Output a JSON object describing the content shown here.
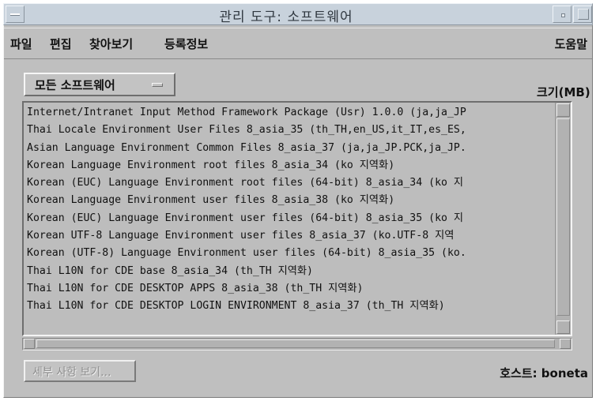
{
  "window": {
    "title": "관리 도구: 소프트웨어"
  },
  "menubar": {
    "file": "파일",
    "edit": "편집",
    "browse": "찾아보기",
    "register": "등록정보",
    "help": "도움말"
  },
  "filter": {
    "selected": "모든 소프트웨어"
  },
  "list": {
    "size_header": "크기(MB)",
    "rows": [
      "Internet/Intranet Input Method Framework Package (Usr) 1.0.0 (ja,ja_JP",
      "Thai Locale Environment User Files 8_asia_35 (th_TH,en_US,it_IT,es_ES,",
      "Asian Language Environment Common Files 8_asia_37 (ja,ja_JP.PCK,ja_JP.",
      "Korean Language Environment root files 8_asia_34 (ko 지역화)",
      "Korean (EUC) Language Environment root files (64-bit) 8_asia_34 (ko 지",
      "Korean Language Environment user files 8_asia_38 (ko 지역화)",
      "Korean (EUC) Language Environment user files (64-bit) 8_asia_35 (ko 지",
      "Korean UTF-8 Language Environment user files 8_asia_37 (ko.UTF-8 지역",
      "Korean (UTF-8) Language Environment user files (64-bit) 8_asia_35 (ko.",
      "Thai L10N for CDE base 8_asia_34 (th_TH 지역화)",
      "Thai L10N for CDE DESKTOP APPS 8_asia_38 (th_TH 지역화)",
      "Thai L10N for CDE DESKTOP LOGIN ENVIRONMENT 8_asia_37 (th_TH 지역화)"
    ]
  },
  "footer": {
    "details_button": "세부 사항 보기...",
    "host_label": "호스트: boneta"
  }
}
